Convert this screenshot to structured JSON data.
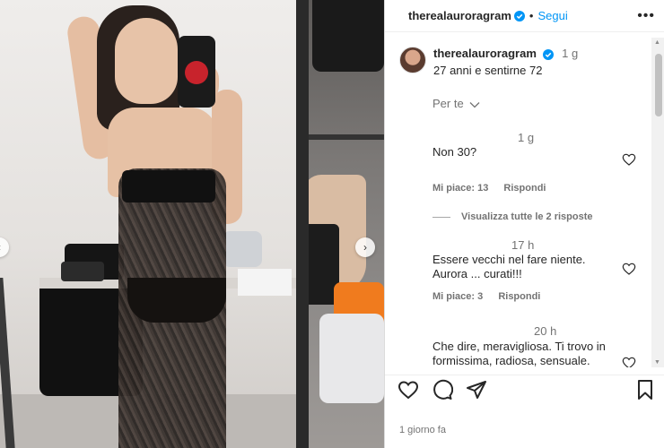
{
  "post": {
    "username": "therealauroragram",
    "follow_label": "Segui",
    "dot_separator": "•",
    "more_label": "•••",
    "caption_time": "1 g",
    "caption_text": "27 anni e sentirne 72",
    "filter_label": "Per te",
    "posted_ago": "1 giorno fa"
  },
  "comments": [
    {
      "time": "1 g",
      "text": "Non 30?",
      "likes_label": "Mi piace: 13",
      "reply_label": "Rispondi",
      "view_replies": "Visualizza tutte le 2 risposte"
    },
    {
      "time": "17 h",
      "text": "Essere vecchi nel fare niente. Aurora ... curati!!!",
      "likes_label": "Mi piace: 3",
      "reply_label": "Rispondi"
    },
    {
      "time": "20 h",
      "text": "Che dire, meravigliosa. Ti trovo in formissima, radiosa, sensuale."
    }
  ],
  "icons": {
    "verified": "verified-badge-icon",
    "more": "more-options-icon",
    "chevron": "chevron-down-icon",
    "heart": "heart-icon",
    "comment": "comment-icon",
    "share": "share-icon",
    "save": "bookmark-icon",
    "carousel_next": "chevron-right-icon"
  },
  "colors": {
    "accent": "#0095f6",
    "text": "#262626",
    "muted": "#737373"
  }
}
